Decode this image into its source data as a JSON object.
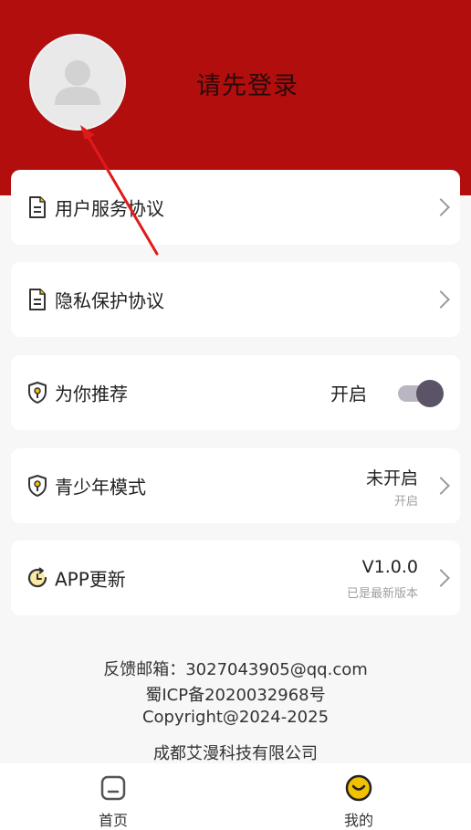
{
  "header": {
    "login_prompt": "请先登录",
    "bg_color": "#b20e0e"
  },
  "menu": {
    "user_agreement": {
      "label": "用户服务协议",
      "icon": "document-icon"
    },
    "privacy": {
      "label": "隐私保护协议",
      "icon": "document-icon"
    },
    "recommend": {
      "label": "为你推荐",
      "status": "开启",
      "enabled": true,
      "icon": "shield-key-icon"
    },
    "youth": {
      "label": "青少年模式",
      "status": "未开启",
      "sub": "开启",
      "icon": "shield-key-icon"
    },
    "update": {
      "label": "APP更新",
      "version": "V1.0.0",
      "sub": "已是最新版本",
      "icon": "refresh-clock-icon"
    }
  },
  "footer": {
    "email_line": "反馈邮箱：3027043905@qq.com",
    "icp": "蜀ICP备2020032968号",
    "copyright": "Copyright@2024-2025",
    "company": "成都艾漫科技有限公司"
  },
  "tabs": [
    {
      "label": "首页",
      "icon": "home-icon"
    },
    {
      "label": "我的",
      "icon": "smiley-icon",
      "accent": "#f2c200"
    }
  ]
}
